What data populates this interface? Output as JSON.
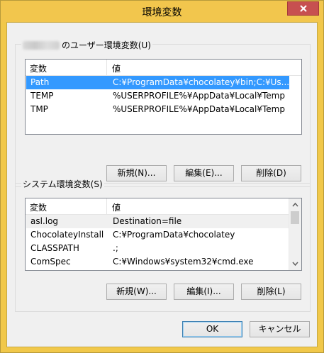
{
  "window": {
    "title": "環境変数"
  },
  "user_vars": {
    "group_title": "のユーザー環境変数(U)",
    "col_name": "変数",
    "col_value": "値",
    "rows": [
      {
        "name": "Path",
        "value": "C:¥ProgramData¥chocolatey¥bin;C:¥Us..."
      },
      {
        "name": "TEMP",
        "value": "%USERPROFILE%¥AppData¥Local¥Temp"
      },
      {
        "name": "TMP",
        "value": "%USERPROFILE%¥AppData¥Local¥Temp"
      }
    ],
    "new_label": "新規(N)...",
    "edit_label": "編集(E)...",
    "delete_label": "削除(D)"
  },
  "system_vars": {
    "group_title": "システム環境変数(S)",
    "col_name": "変数",
    "col_value": "値",
    "rows": [
      {
        "name": "asl.log",
        "value": "Destination=file"
      },
      {
        "name": "ChocolateyInstall",
        "value": "C:¥ProgramData¥chocolatey"
      },
      {
        "name": "CLASSPATH",
        "value": ".;"
      },
      {
        "name": "ComSpec",
        "value": "C:¥Windows¥system32¥cmd.exe"
      }
    ],
    "new_label": "新規(W)...",
    "edit_label": "編集(I)...",
    "delete_label": "削除(L)"
  },
  "ok_label": "OK",
  "cancel_label": "キャンセル",
  "icons": {
    "close": "close-icon",
    "scroll_up": "chevron-up-icon",
    "scroll_down": "chevron-down-icon"
  }
}
